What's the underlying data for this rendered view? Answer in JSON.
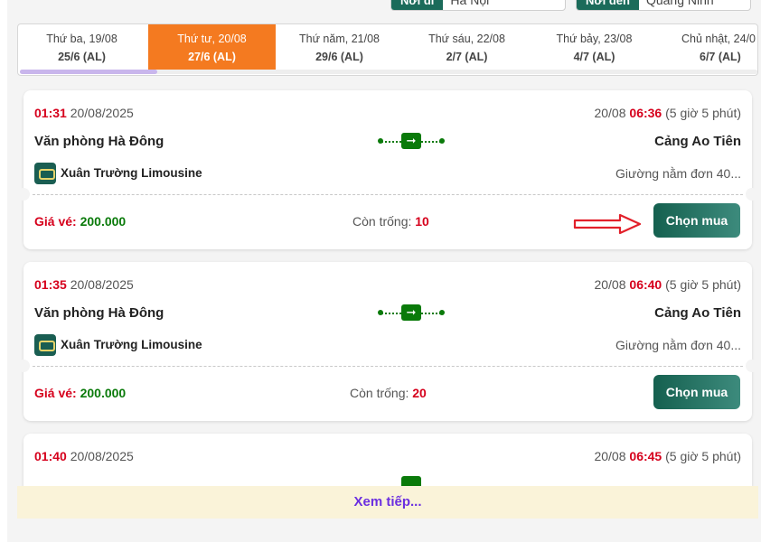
{
  "filters": {
    "from_label": "Nơi đi",
    "from_value": "Hà Nội",
    "to_label": "Nơi đến",
    "to_value": "Quảng Ninh"
  },
  "dates": [
    {
      "day": "Thứ ba, 19/08",
      "lunar": "25/6 (AL)",
      "active": false
    },
    {
      "day": "Thứ tư, 20/08",
      "lunar": "27/6 (AL)",
      "active": true
    },
    {
      "day": "Thứ năm, 21/08",
      "lunar": "29/6 (AL)",
      "active": false
    },
    {
      "day": "Thứ sáu, 22/08",
      "lunar": "2/7 (AL)",
      "active": false
    },
    {
      "day": "Thứ bảy, 23/08",
      "lunar": "4/7 (AL)",
      "active": false
    },
    {
      "day": "Chủ nhật, 24/0",
      "lunar": "6/7 (AL)",
      "active": false
    }
  ],
  "trips": [
    {
      "dep_time": "01:31",
      "dep_date": "20/08/2025",
      "arr_date": "20/08",
      "arr_time": "06:36",
      "duration": "(5 giờ 5 phút)",
      "from": "Văn phòng Hà Đông",
      "to": "Cảng Ao Tiên",
      "operator": "Xuân Trường Limousine",
      "seat_type": "Giường nằm đơn 40...",
      "price_label": "Giá vé:",
      "price": "200.000",
      "seats_label": "Còn trống:",
      "seats": "10",
      "buy_label": "Chọn mua"
    },
    {
      "dep_time": "01:35",
      "dep_date": "20/08/2025",
      "arr_date": "20/08",
      "arr_time": "06:40",
      "duration": "(5 giờ 5 phút)",
      "from": "Văn phòng Hà Đông",
      "to": "Cảng Ao Tiên",
      "operator": "Xuân Trường Limousine",
      "seat_type": "Giường nằm đơn 40...",
      "price_label": "Giá vé:",
      "price": "200.000",
      "seats_label": "Còn trống:",
      "seats": "20",
      "buy_label": "Chọn mua"
    },
    {
      "dep_time": "01:40",
      "dep_date": "20/08/2025",
      "arr_date": "20/08",
      "arr_time": "06:45",
      "duration": "(5 giờ 5 phút)"
    }
  ],
  "load_more": "Xem tiếp...",
  "colors": {
    "accent_orange": "#f47a20",
    "primary_green": "#15604f",
    "time_red": "#d6001c",
    "price_green": "#0a7a0a",
    "load_more_text": "#6b2fe0"
  }
}
